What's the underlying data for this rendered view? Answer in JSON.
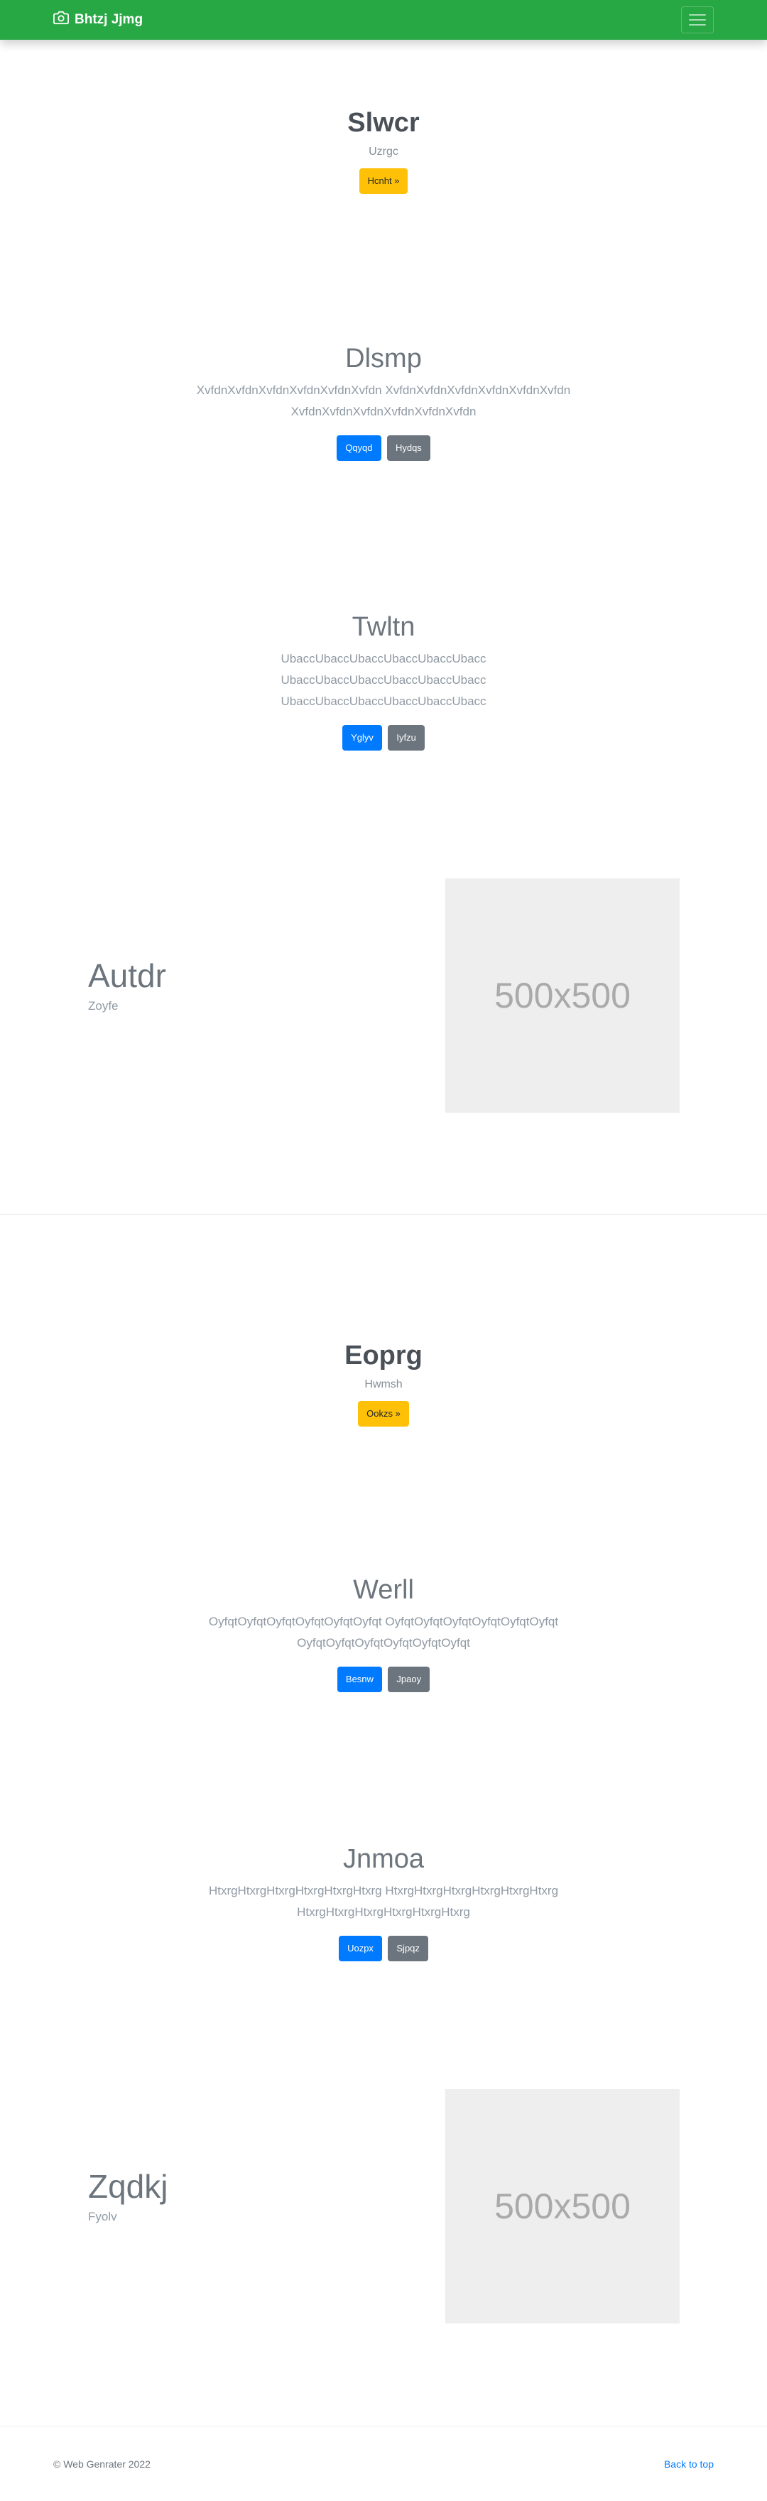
{
  "navbar": {
    "brand": "Bhtzj Jjmg",
    "brand_icon": "camera-icon",
    "toggler_icon": "menu-icon"
  },
  "hero1": {
    "title": "Slwcr",
    "subtitle": "Uzrgc",
    "button": "Hcnht »"
  },
  "sec1": {
    "title": "Dlsmp",
    "lines": [
      "XvfdnXvfdnXvfdnXvfdnXvfdnXvfdn XvfdnXvfdnXvfdnXvfdnXvfdnXvfdn",
      "XvfdnXvfdnXvfdnXvfdnXvfdnXvfdn"
    ],
    "primary": "Qqyqd",
    "secondary": "Hydqs"
  },
  "sec2": {
    "title": "Twltn",
    "lines": [
      "UbaccUbaccUbaccUbaccUbaccUbacc",
      "UbaccUbaccUbaccUbaccUbaccUbacc",
      "UbaccUbaccUbaccUbaccUbaccUbacc"
    ],
    "primary": "Yglyv",
    "secondary": "Iyfzu"
  },
  "feature1": {
    "title": "Autdr",
    "subtitle": "Zoyfe",
    "image_label": "500x500"
  },
  "hero2": {
    "title": "Eoprg",
    "subtitle": "Hwmsh",
    "button": "Ookzs »"
  },
  "sec3": {
    "title": "Werll",
    "lines": [
      "OyfqtOyfqtOyfqtOyfqtOyfqtOyfqt OyfqtOyfqtOyfqtOyfqtOyfqtOyfqt",
      "OyfqtOyfqtOyfqtOyfqtOyfqtOyfqt"
    ],
    "primary": "Besnw",
    "secondary": "Jpaoy"
  },
  "sec4": {
    "title": "Jnmoa",
    "lines": [
      "HtxrgHtxrgHtxrgHtxrgHtxrgHtxrg HtxrgHtxrgHtxrgHtxrgHtxrgHtxrg",
      "HtxrgHtxrgHtxrgHtxrgHtxrgHtxrg"
    ],
    "primary": "Uozpx",
    "secondary": "Sjpqz"
  },
  "feature2": {
    "title": "Zqdkj",
    "subtitle": "Fyolv",
    "image_label": "500x500"
  },
  "footer": {
    "copyright": "© Web Genrater 2022",
    "back_to_top": "Back to top"
  },
  "colors": {
    "navbar": "#28a745",
    "warning": "#ffc107",
    "primary": "#007bff",
    "secondary": "#6c757d"
  }
}
